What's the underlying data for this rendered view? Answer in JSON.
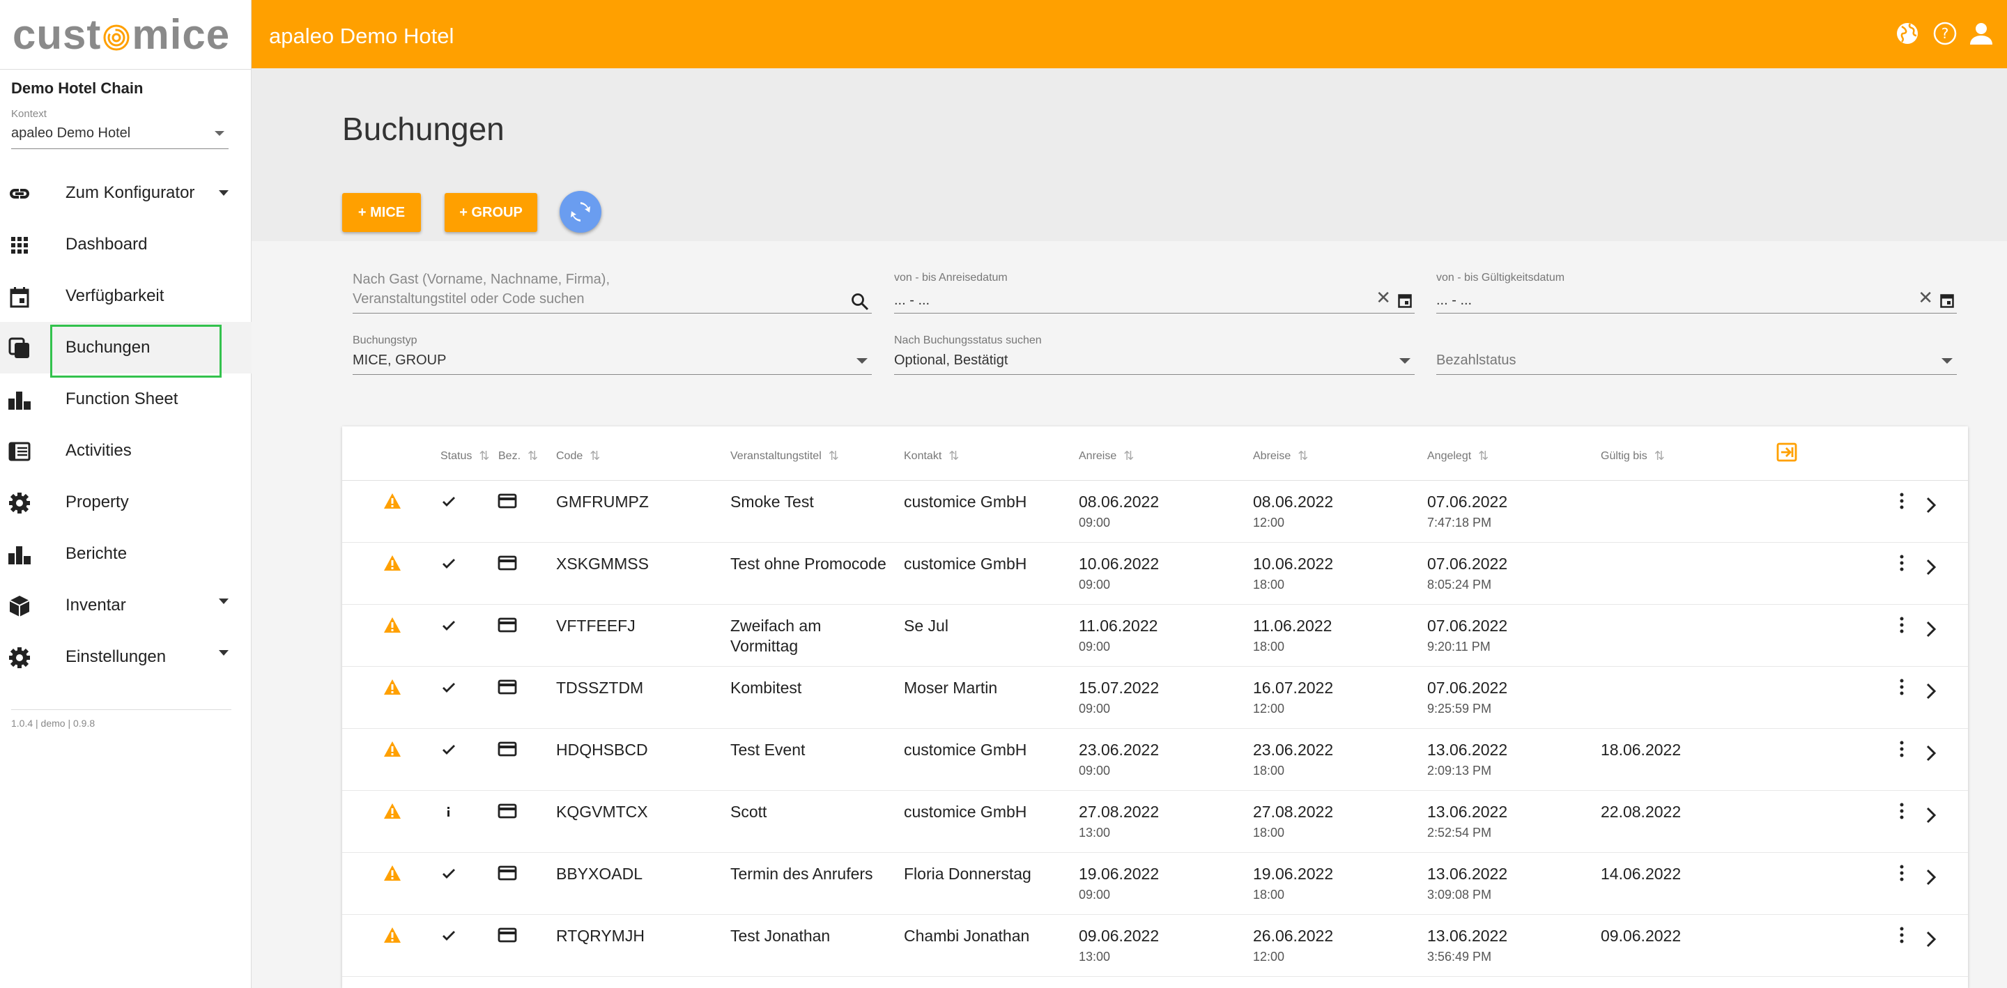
{
  "sidebar": {
    "logo_text_left": "cust",
    "logo_text_right": "mice",
    "chain": "Demo Hotel Chain",
    "kontext_label": "Kontext",
    "kontext_value": "apaleo Demo Hotel",
    "items": [
      {
        "label": "Zum Konfigurator",
        "icon": "link-icon"
      },
      {
        "label": "Dashboard",
        "icon": "grid-icon"
      },
      {
        "label": "Verfügbarkeit",
        "icon": "calendar-icon"
      },
      {
        "label": "Buchungen",
        "icon": "copy-icon"
      },
      {
        "label": "Function Sheet",
        "icon": "bar-chart-icon"
      },
      {
        "label": "Activities",
        "icon": "document-icon"
      },
      {
        "label": "Property",
        "icon": "gear-icon"
      },
      {
        "label": "Berichte",
        "icon": "bar-chart-icon"
      },
      {
        "label": "Inventar",
        "icon": "cube-icon"
      },
      {
        "label": "Einstellungen",
        "icon": "gear-icon"
      }
    ],
    "version": "1.0.4 | demo | 0.9.8"
  },
  "topbar": {
    "title": "apaleo Demo Hotel",
    "icons": [
      "globe-icon",
      "help-icon",
      "user-icon"
    ],
    "color": "#ffa000"
  },
  "main": {
    "title": "Buchungen",
    "btn_mice": "+ MICE",
    "btn_group": "+ GROUP"
  },
  "filters": {
    "search_placeholder_1": "Nach Gast (Vorname, Nachname, Firma),",
    "search_placeholder_2": "Veranstaltungstitel oder Code suchen",
    "arrival_label": "von - bis Anreisedatum",
    "arrival_value": "... - ...",
    "valid_label": "von - bis Gültigkeitsdatum",
    "valid_value": "... - ...",
    "type_label": "Buchungstyp",
    "type_value": "MICE, GROUP",
    "status_label": "Nach Buchungsstatus suchen",
    "status_value": "Optional, Bestätigt",
    "payment_placeholder": "Bezahlstatus"
  },
  "table": {
    "headers": [
      "Status",
      "Bez.",
      "Code",
      "Veranstaltungstitel",
      "Kontakt",
      "Anreise",
      "Abreise",
      "Angelegt",
      "Gültig bis"
    ],
    "rows": [
      {
        "status": "check",
        "code": "GMFRUMPZ",
        "title": "Smoke Test",
        "title2": "",
        "contact": "customice GmbH",
        "arrival": "08.06.2022",
        "arrival_time": "09:00",
        "departure": "08.06.2022",
        "departure_time": "12:00",
        "created": "07.06.2022",
        "created_time": "7:47:18 PM",
        "valid": ""
      },
      {
        "status": "check",
        "code": "XSKGMMSS",
        "title": "Test ohne Promocode",
        "title2": "",
        "contact": "customice GmbH",
        "arrival": "10.06.2022",
        "arrival_time": "09:00",
        "departure": "10.06.2022",
        "departure_time": "18:00",
        "created": "07.06.2022",
        "created_time": "8:05:24 PM",
        "valid": ""
      },
      {
        "status": "check",
        "code": "VFTFEEFJ",
        "title": "Zweifach am",
        "title2": "Vormittag",
        "contact": "Se Jul",
        "arrival": "11.06.2022",
        "arrival_time": "09:00",
        "departure": "11.06.2022",
        "departure_time": "18:00",
        "created": "07.06.2022",
        "created_time": "9:20:11 PM",
        "valid": ""
      },
      {
        "status": "check",
        "code": "TDSSZTDM",
        "title": "Kombitest",
        "title2": "",
        "contact": "Moser Martin",
        "arrival": "15.07.2022",
        "arrival_time": "09:00",
        "departure": "16.07.2022",
        "departure_time": "12:00",
        "created": "07.06.2022",
        "created_time": "9:25:59 PM",
        "valid": ""
      },
      {
        "status": "check",
        "code": "HDQHSBCD",
        "title": "Test Event",
        "title2": "",
        "contact": "customice GmbH",
        "arrival": "23.06.2022",
        "arrival_time": "09:00",
        "departure": "23.06.2022",
        "departure_time": "18:00",
        "created": "13.06.2022",
        "created_time": "2:09:13 PM",
        "valid": "18.06.2022"
      },
      {
        "status": "info",
        "code": "KQGVMTCX",
        "title": "Scott",
        "title2": "",
        "contact": "customice GmbH",
        "arrival": "27.08.2022",
        "arrival_time": "13:00",
        "departure": "27.08.2022",
        "departure_time": "18:00",
        "created": "13.06.2022",
        "created_time": "2:52:54 PM",
        "valid": "22.08.2022"
      },
      {
        "status": "check",
        "code": "BBYXOADL",
        "title": "Termin des Anrufers",
        "title2": "",
        "contact": "Floria Donnerstag",
        "arrival": "19.06.2022",
        "arrival_time": "09:00",
        "departure": "19.06.2022",
        "departure_time": "18:00",
        "created": "13.06.2022",
        "created_time": "3:09:08 PM",
        "valid": "14.06.2022"
      },
      {
        "status": "check",
        "code": "RTQRYMJH",
        "title": "Test Jonathan",
        "title2": "",
        "contact": "Chambi Jonathan",
        "arrival": "09.06.2022",
        "arrival_time": "13:00",
        "departure": "26.06.2022",
        "departure_time": "12:00",
        "created": "13.06.2022",
        "created_time": "3:56:49 PM",
        "valid": "09.06.2022"
      }
    ]
  }
}
